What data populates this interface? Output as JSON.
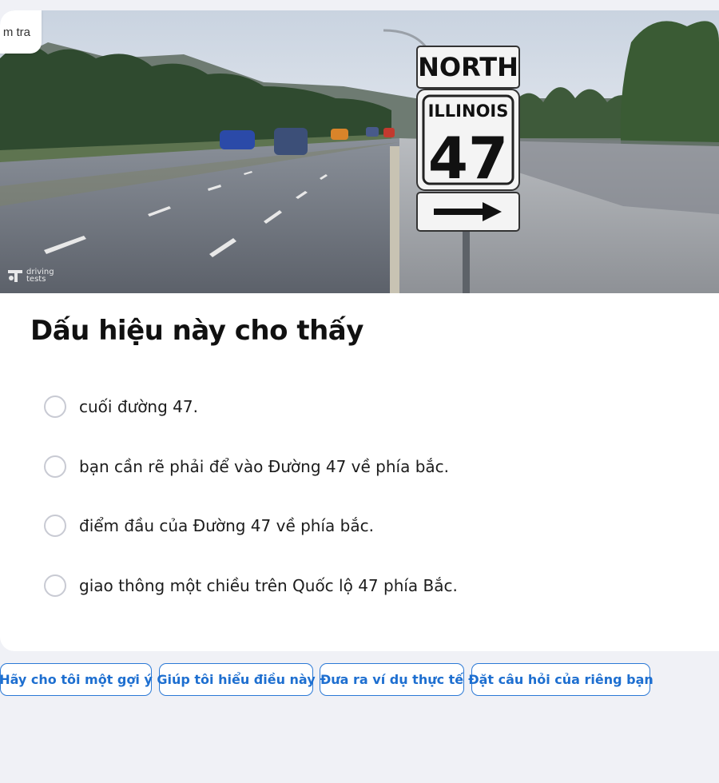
{
  "chip": {
    "label": "m tra"
  },
  "scene": {
    "sign_top": "NORTH",
    "sign_state": "ILLINOIS",
    "sign_number": "47",
    "watermark_line1": "driving",
    "watermark_line2": "tests"
  },
  "question": {
    "title": "Dấu hiệu này cho thấy"
  },
  "options": [
    {
      "label": "cuối đường 47."
    },
    {
      "label": "bạn cần rẽ phải để vào Đường 47 về phía bắc."
    },
    {
      "label": "điểm đầu của Đường 47 về phía bắc."
    },
    {
      "label": "giao thông một chiều trên Quốc lộ 47 phía Bắc."
    }
  ],
  "suggestions": [
    {
      "label": "Hãy cho tôi một gợi ý"
    },
    {
      "label": "Giúp tôi hiểu điều này"
    },
    {
      "label": "Đưa ra ví dụ thực tế"
    },
    {
      "label": "Đặt câu hỏi của riêng bạn"
    }
  ],
  "colors": {
    "accent": "#2b79d6",
    "page_bg": "#f0f1f6",
    "radio_border": "#c8cad3"
  }
}
